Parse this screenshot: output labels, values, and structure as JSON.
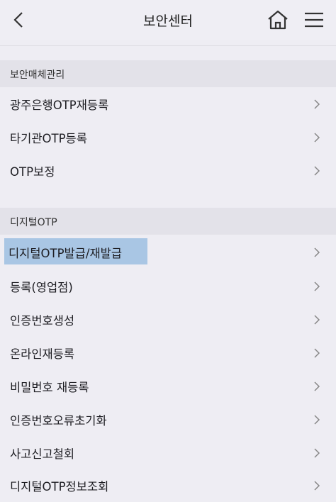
{
  "header": {
    "title": "보안센터",
    "back_icon": "chevron-left-icon",
    "home_icon": "home-icon",
    "menu_icon": "hamburger-menu-icon"
  },
  "sections": [
    {
      "title": "보안매체관리",
      "items": [
        {
          "label": "광주은행OTP재등록"
        },
        {
          "label": "타기관OTP등록"
        },
        {
          "label": "OTP보정"
        }
      ]
    },
    {
      "title": "디지털OTP",
      "items": [
        {
          "label": "디지털OTP발급/재발급",
          "selected": true
        },
        {
          "label": "등록(영업점)"
        },
        {
          "label": "인증번호생성"
        },
        {
          "label": "온라인재등록"
        },
        {
          "label": "비밀번호 재등록"
        },
        {
          "label": "인증번호오류초기화"
        },
        {
          "label": "사고신고철회"
        },
        {
          "label": "디지털OTP정보조회"
        }
      ]
    }
  ],
  "colors": {
    "background": "#eeedf3",
    "section_header": "#e3e2e9",
    "selection_highlight": "#a9c6e4"
  }
}
